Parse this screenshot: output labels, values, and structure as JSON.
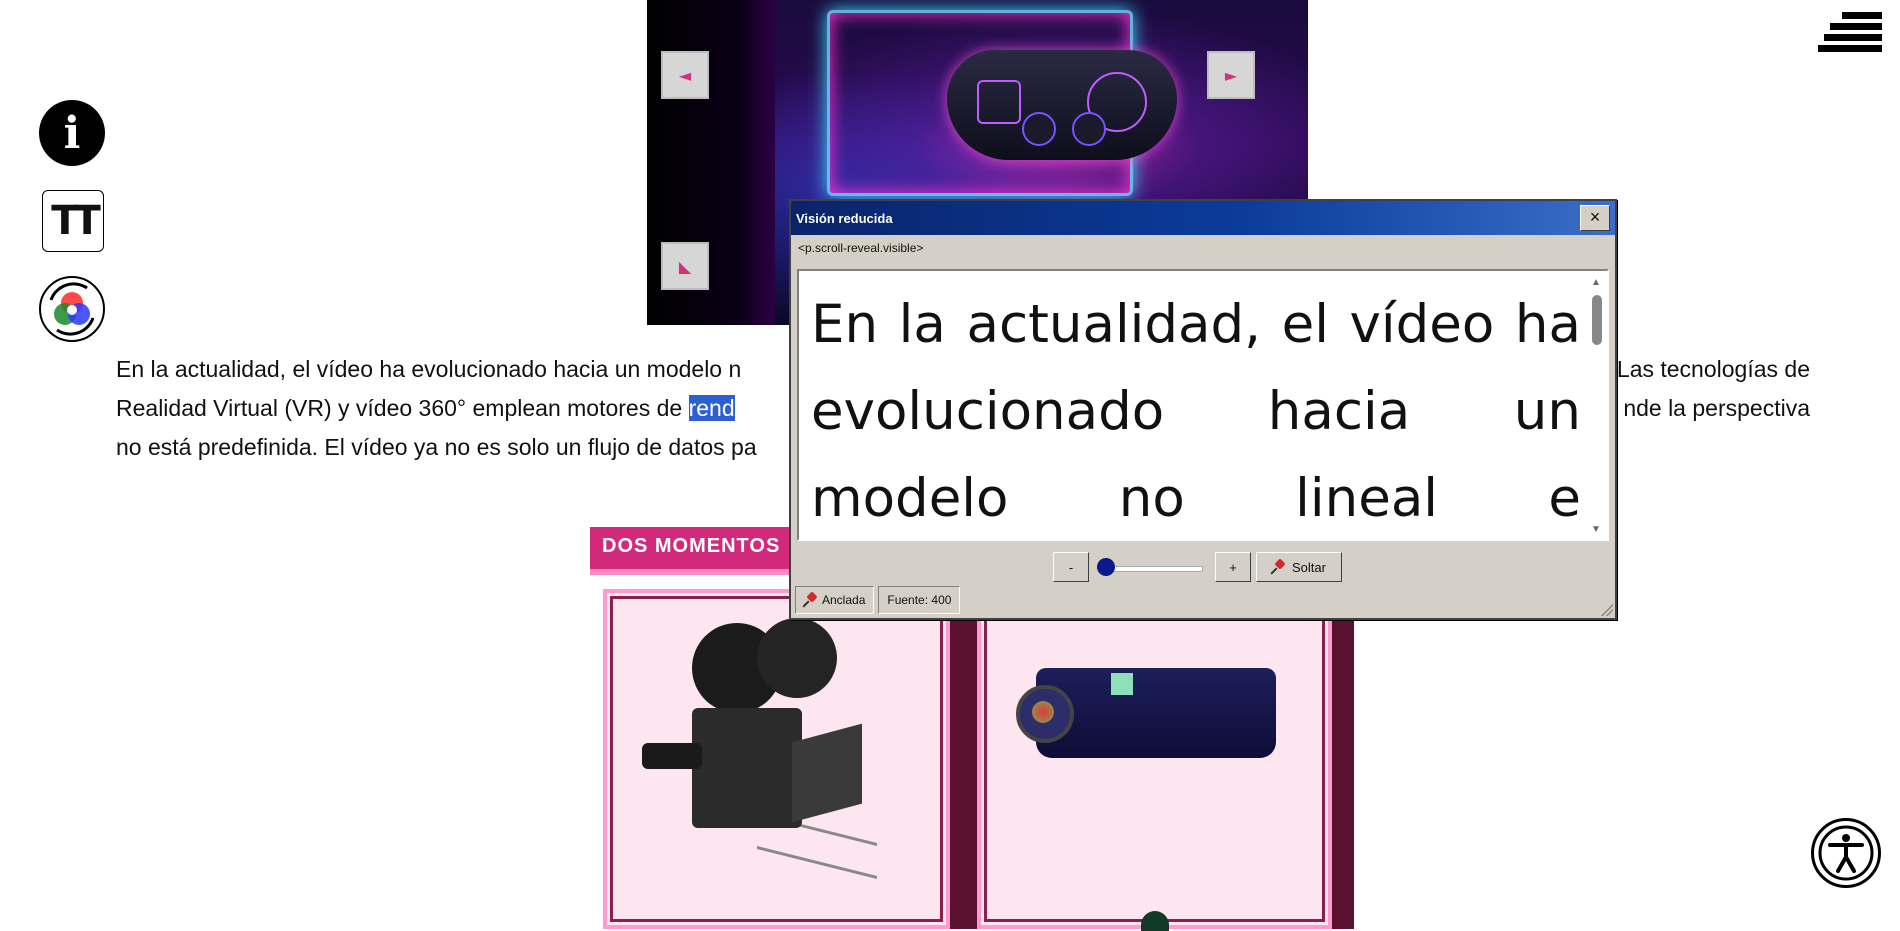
{
  "carousel": {
    "prev_label": "◄",
    "next_label": "►",
    "third_label": "◣"
  },
  "tools": {
    "info_label": "i",
    "text_size_label": "TT"
  },
  "paragraph": {
    "line1_start": "En la actualidad, el vídeo ha evolucionado hacia un modelo n",
    "line1_end": "Las tecnologías de",
    "line2_start": "Realidad Virtual (VR) y vídeo 360° emplean motores de ",
    "line2_selected": "rend",
    "line2_end": "nde la perspectiva",
    "line3_start": "no está predefinida. El vídeo ya no es solo un flujo de datos pa"
  },
  "section": {
    "heading": "DOS MOMENTOS"
  },
  "dialog": {
    "title": "Visión reducida",
    "close_label": "×",
    "element_path": "<p.scroll-reveal.visible>",
    "magnified_text": "En la actualidad, el vídeo ha evolucionado hacia un modelo no lineal e",
    "minus_label": "-",
    "plus_label": "+",
    "release_label": "Soltar",
    "anchored_label": "Anclada",
    "font_label": "Fuente: 400",
    "slider_value": 0
  },
  "colors": {
    "accent": "#d12a7c",
    "selection": "#2c5fd4",
    "dialog_title": "#0a246a"
  }
}
